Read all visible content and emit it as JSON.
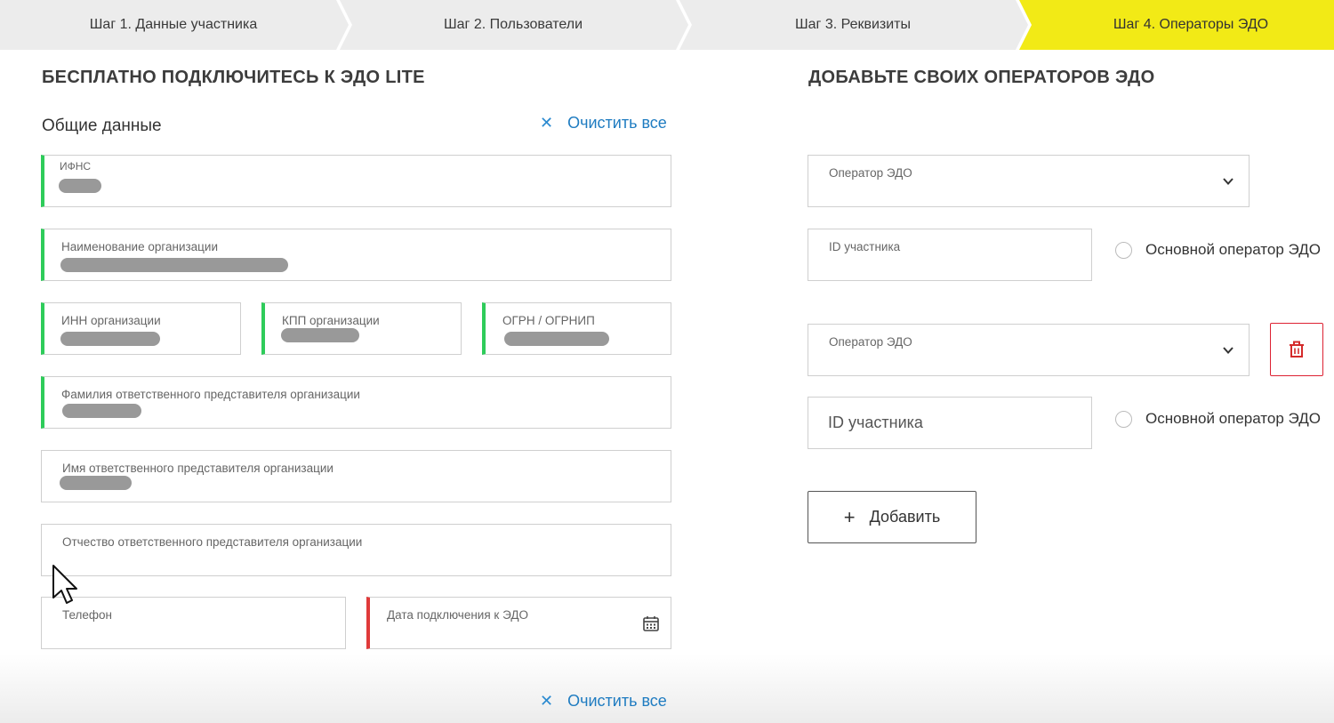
{
  "steps": [
    {
      "label": "Шаг 1. Данные участника",
      "active": false
    },
    {
      "label": "Шаг 2. Пользователи",
      "active": false
    },
    {
      "label": "Шаг 3. Реквизиты",
      "active": false
    },
    {
      "label": "Шаг 4. Операторы ЭДО",
      "active": true
    }
  ],
  "colors": {
    "step_bg": "#ececec",
    "step_active_bg": "#f2ea16",
    "valid_green": "#2ecc5a",
    "error_red": "#e03a3a",
    "link_blue": "#1f7cc1"
  },
  "left": {
    "heading": "БЕСПЛАТНО ПОДКЛЮЧИТЕСЬ К ЭДО LITE",
    "section_title": "Общие данные",
    "clear_all": "Очистить все",
    "fields": {
      "ifns": "ИФНС",
      "org_name": "Наименование организации",
      "inn": "ИНН организации",
      "kpp": "КПП организации",
      "ogrn": "ОГРН / ОГРНИП",
      "last_name": "Фамилия ответственного представителя организации",
      "first_name": "Имя ответственного представителя организации",
      "patronymic": "Отчество ответственного представителя организации",
      "phone": "Телефон",
      "connect_date": "Дата подключения к ЭДО"
    }
  },
  "right": {
    "heading": "ДОБАВЬТЕ СВОИХ ОПЕРАТОРОВ ЭДО",
    "operator_label": "Оператор ЭДО",
    "participant_id_label": "ID участника",
    "participant_id_placeholder": "ID участника",
    "main_operator_label": "Основной оператор ЭДО",
    "add_button": "Добавить"
  },
  "footer": {
    "clear_all": "Очистить все"
  }
}
